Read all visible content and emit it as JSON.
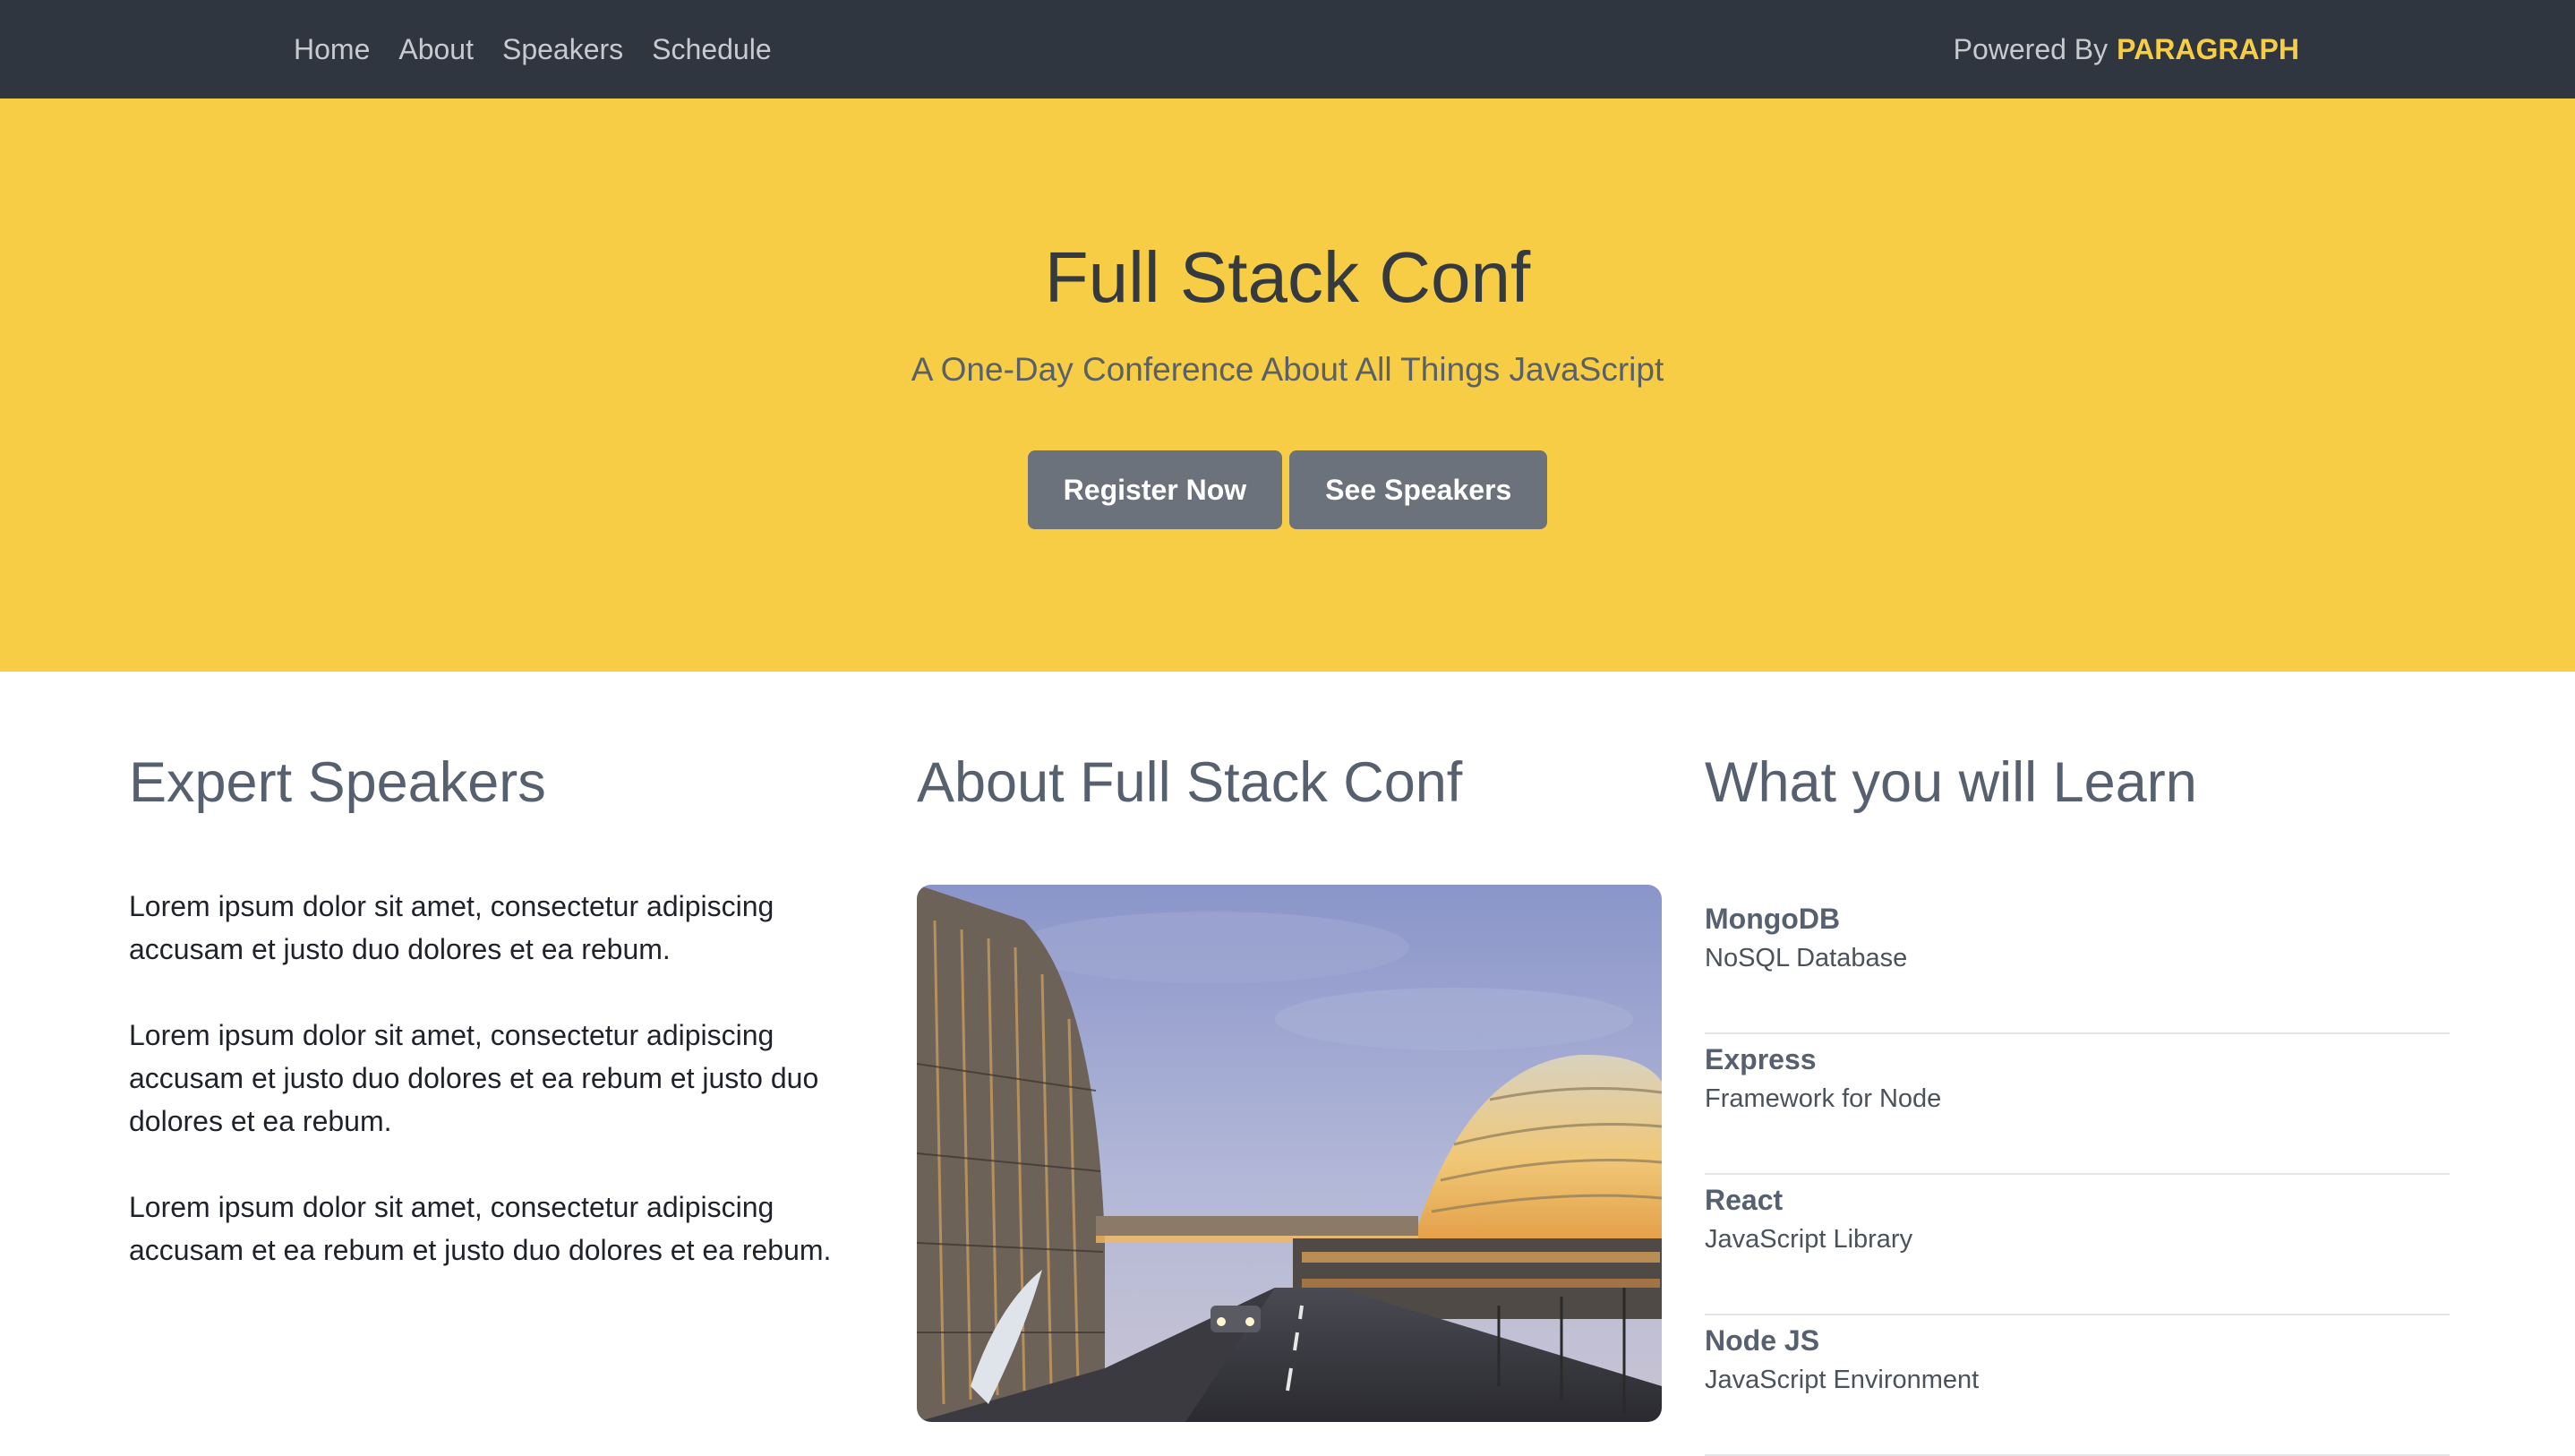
{
  "nav": {
    "links": [
      "Home",
      "About",
      "Speakers",
      "Schedule"
    ],
    "powered_by": "Powered By",
    "brand": "PARAGRAPH"
  },
  "hero": {
    "title": "Full Stack Conf",
    "subtitle": "A One-Day Conference About All Things JavaScript",
    "register_label": "Register Now",
    "speakers_label": "See Speakers",
    "background": "#f7cd45"
  },
  "speakers": {
    "heading": "Expert Speakers",
    "paragraphs": [
      "Lorem ipsum dolor sit amet, consectetur adipiscing accusam et justo duo dolores et ea rebum.",
      "Lorem ipsum dolor sit amet, consectetur adipiscing accusam et justo duo dolores et ea rebum et justo duo dolores et ea rebum.",
      "Lorem ipsum dolor sit amet, consectetur adipiscing accusam et ea rebum et justo duo dolores et ea rebum."
    ]
  },
  "about": {
    "heading": "About Full Stack Conf",
    "image_icon": "conference-venue-photo"
  },
  "learn": {
    "heading": "What you will Learn",
    "items": [
      {
        "name": "MongoDB",
        "desc": "NoSQL Database"
      },
      {
        "name": "Express",
        "desc": "Framework for Node"
      },
      {
        "name": "React",
        "desc": "JavaScript Library"
      },
      {
        "name": "Node JS",
        "desc": "JavaScript Environment"
      }
    ]
  },
  "colors": {
    "navbar": "#2f3640",
    "accent": "#f7cd45",
    "button": "#6c727b",
    "heading": "#56606e"
  }
}
